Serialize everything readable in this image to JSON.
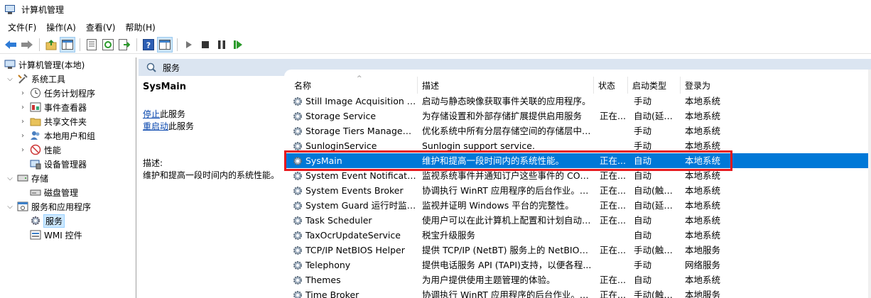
{
  "window": {
    "title": "计算机管理",
    "icon": "computer-management-icon"
  },
  "menu": [
    "文件(F)",
    "操作(A)",
    "查看(V)",
    "帮助(H)"
  ],
  "toolbar": {
    "buttons": [
      "back-arrow-icon",
      "forward-arrow-icon",
      "up-folder-icon",
      "show-hide-tree-icon",
      "properties-icon",
      "refresh-icon",
      "export-list-icon",
      "help-icon",
      "show-hide-action-pane-icon",
      "start-service-icon",
      "stop-service-icon",
      "pause-service-icon",
      "resume-service-icon"
    ]
  },
  "tree": {
    "root": "计算机管理(本地)",
    "system_tools": "系统工具",
    "task_scheduler": "任务计划程序",
    "event_viewer": "事件查看器",
    "shared_folders": "共享文件夹",
    "local_users": "本地用户和组",
    "performance": "性能",
    "device_manager": "设备管理器",
    "storage": "存储",
    "disk_management": "磁盘管理",
    "services_apps": "服务和应用程序",
    "services": "服务",
    "wmi": "WMI 控件"
  },
  "panel": {
    "title": "服务"
  },
  "details": {
    "service_name": "SysMain",
    "stop_link": "停止",
    "stop_suffix": "此服务",
    "restart_link": "重启动",
    "restart_suffix": "此服务",
    "desc_label": "描述:",
    "description": "维护和提高一段时间内的系统性能。"
  },
  "columns": {
    "name": "名称",
    "description": "描述",
    "status": "状态",
    "startup": "启动类型",
    "logon": "登录为"
  },
  "services": [
    {
      "name": "Still Image Acquisition Ev...",
      "desc": "启动与静态映像获取事件关联的应用程序。",
      "status": "",
      "startup": "手动",
      "logon": "本地系统"
    },
    {
      "name": "Storage Service",
      "desc": "为存储设置和外部存储扩展提供启用服务",
      "status": "正在...",
      "startup": "自动(延迟...",
      "logon": "本地系统"
    },
    {
      "name": "Storage Tiers Managem...",
      "desc": "优化系统中所有分层存储空间的存储层中的...",
      "status": "",
      "startup": "手动",
      "logon": "本地系统"
    },
    {
      "name": "SunloginService",
      "desc": "Sunlogin support service.",
      "status": "",
      "startup": "手动",
      "logon": "本地系统"
    },
    {
      "name": "SysMain",
      "desc": "维护和提高一段时间内的系统性能。",
      "status": "正在...",
      "startup": "自动",
      "logon": "本地系统"
    },
    {
      "name": "System Event Notification...",
      "desc": "监视系统事件并通知订户这些事件的 COM...",
      "status": "正在...",
      "startup": "自动",
      "logon": "本地系统"
    },
    {
      "name": "System Events Broker",
      "desc": "协调执行 WinRT 应用程序的后台作业。如...",
      "status": "正在...",
      "startup": "自动(触发...",
      "logon": "本地系统"
    },
    {
      "name": "System Guard 运行时监视...",
      "desc": "监视并证明 Windows 平台的完整性。",
      "status": "正在...",
      "startup": "自动(延迟...",
      "logon": "本地系统"
    },
    {
      "name": "Task Scheduler",
      "desc": "使用户可以在此计算机上配置和计划自动任...",
      "status": "正在...",
      "startup": "自动",
      "logon": "本地系统"
    },
    {
      "name": "TaxOcrUpdateService",
      "desc": "税宝升级服务",
      "status": "",
      "startup": "自动",
      "logon": "本地系统"
    },
    {
      "name": "TCP/IP NetBIOS Helper",
      "desc": "提供 TCP/IP (NetBT) 服务上的 NetBIOS ...",
      "status": "正在...",
      "startup": "手动(触发...",
      "logon": "本地服务"
    },
    {
      "name": "Telephony",
      "desc": "提供电话服务 API (TAPI)支持，以便各程...",
      "status": "",
      "startup": "手动",
      "logon": "网络服务"
    },
    {
      "name": "Themes",
      "desc": "为用户提供使用主题管理的体验。",
      "status": "正在...",
      "startup": "自动",
      "logon": "本地系统"
    },
    {
      "name": "Time Broker",
      "desc": "协调执行 WinRT 应用程序的后台作业。如...",
      "status": "正在...",
      "startup": "手动(触发...",
      "logon": "本地服务"
    }
  ],
  "selected_service": "SysMain",
  "colors": {
    "selection": "#0078d7",
    "highlight_box": "#e8191e",
    "header_bg": "#dbe5f1"
  }
}
